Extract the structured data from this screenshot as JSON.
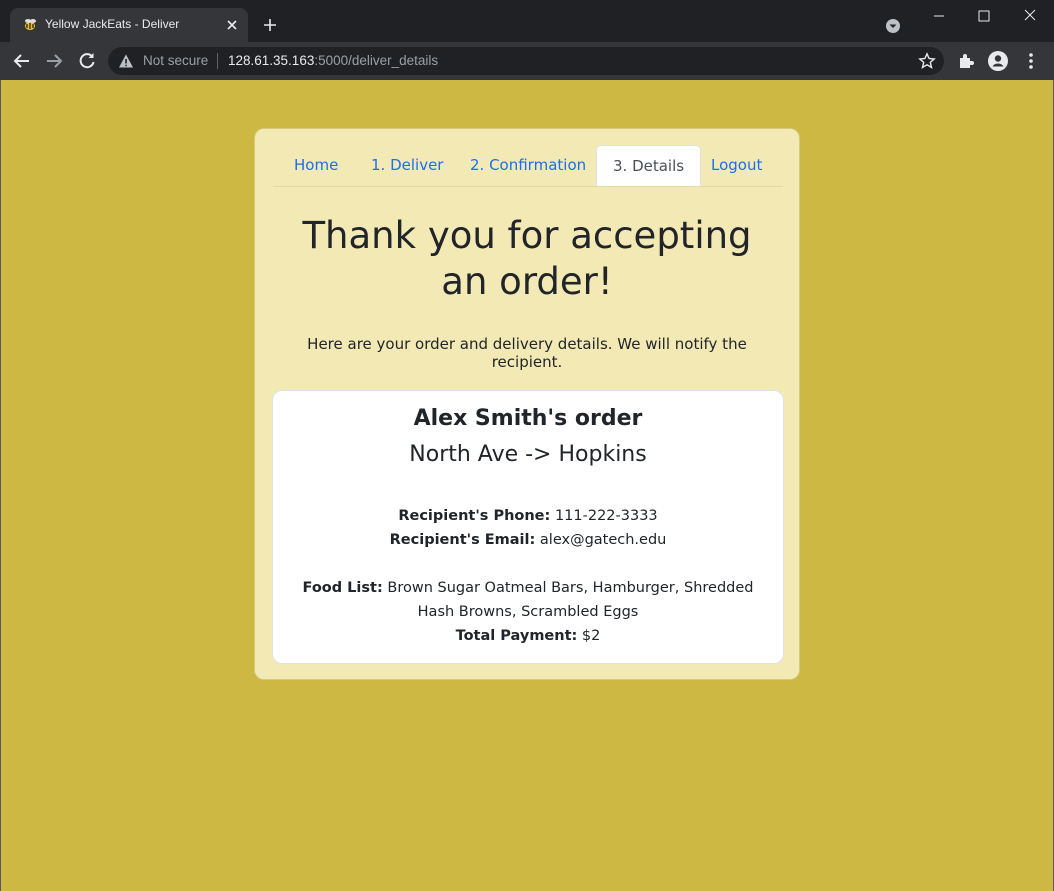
{
  "browser": {
    "tab_title": "Yellow JackEats - Deliver",
    "security_label": "Not secure",
    "url_host": "128.61.35.163",
    "url_rest": ":5000/deliver_details"
  },
  "nav": {
    "items": [
      {
        "label": "Home"
      },
      {
        "label": "1. Deliver"
      },
      {
        "label": "2. Confirmation"
      },
      {
        "label": "3. Details",
        "active": true
      },
      {
        "label": "Logout"
      }
    ]
  },
  "page": {
    "heading": "Thank you for accepting an order!",
    "subtext": "Here are your order and delivery details. We will notify the recipient."
  },
  "order": {
    "title": "Alex Smith's order",
    "route": "North Ave -> Hopkins",
    "phone_label": "Recipient's Phone:",
    "phone": "111-222-3333",
    "email_label": "Recipient's Email:",
    "email": "alex@gatech.edu",
    "food_label": "Food List:",
    "food_list": "Brown Sugar Oatmeal Bars, Hamburger, Shredded Hash Browns, Scrambled Eggs",
    "payment_label": "Total Payment:",
    "payment": "$2"
  },
  "colors": {
    "page_background": "#ccb843",
    "card_background": "#f3e9b5",
    "link": "#1a6ef0"
  }
}
